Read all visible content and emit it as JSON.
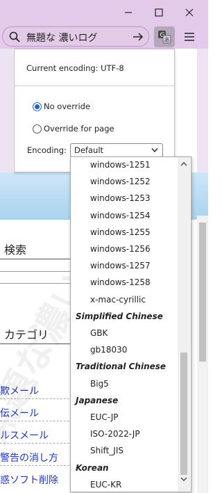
{
  "toolbar": {
    "page_title": "無題な 濃いログ",
    "search_icon": "search-icon",
    "go_icon": "arrow-right-icon",
    "translate_icon": "translate-icon",
    "menu_icon": "hamburger-menu-icon"
  },
  "window": {
    "minimize_icon": "minimize-icon",
    "maximize_icon": "maximize-icon",
    "close_icon": "close-icon"
  },
  "encoding_panel": {
    "current_encoding": "Current encoding: UTF-8",
    "option_no_override": "No override",
    "option_override_page": "Override for page",
    "selected_option": "No override",
    "encoding_label": "Encoding:",
    "encoding_select_value": "Default"
  },
  "dropdown": {
    "entries": [
      {
        "kind": "item",
        "label": "windows-1251"
      },
      {
        "kind": "item",
        "label": "windows-1252"
      },
      {
        "kind": "item",
        "label": "windows-1253"
      },
      {
        "kind": "item",
        "label": "windows-1254"
      },
      {
        "kind": "item",
        "label": "windows-1255"
      },
      {
        "kind": "item",
        "label": "windows-1256"
      },
      {
        "kind": "item",
        "label": "windows-1257"
      },
      {
        "kind": "item",
        "label": "windows-1258"
      },
      {
        "kind": "item",
        "label": "x-mac-cyrillic"
      },
      {
        "kind": "group",
        "label": "Simplified Chinese"
      },
      {
        "kind": "item",
        "label": "GBK"
      },
      {
        "kind": "item",
        "label": "gb18030"
      },
      {
        "kind": "group",
        "label": "Traditional Chinese"
      },
      {
        "kind": "item",
        "label": "Big5"
      },
      {
        "kind": "group",
        "label": "Japanese"
      },
      {
        "kind": "item",
        "label": "EUC-JP"
      },
      {
        "kind": "item",
        "label": "ISO-2022-JP"
      },
      {
        "kind": "item",
        "label": "Shift_JIS"
      },
      {
        "kind": "group",
        "label": "Korean"
      },
      {
        "kind": "item",
        "label": "EUC-KR"
      }
    ]
  },
  "page": {
    "search_heading": "検索",
    "category_heading": "カテゴリ",
    "category_links": [
      "欺メール",
      "伝メール",
      "ルスメール",
      "警告の消し方",
      "惑ソフト削除"
    ],
    "watermark": "無題な濃いログ"
  },
  "colors": {
    "chrome_lavender": "#e3c9ea",
    "link_blue": "#2035c8",
    "radio_blue": "#1d63c9"
  }
}
